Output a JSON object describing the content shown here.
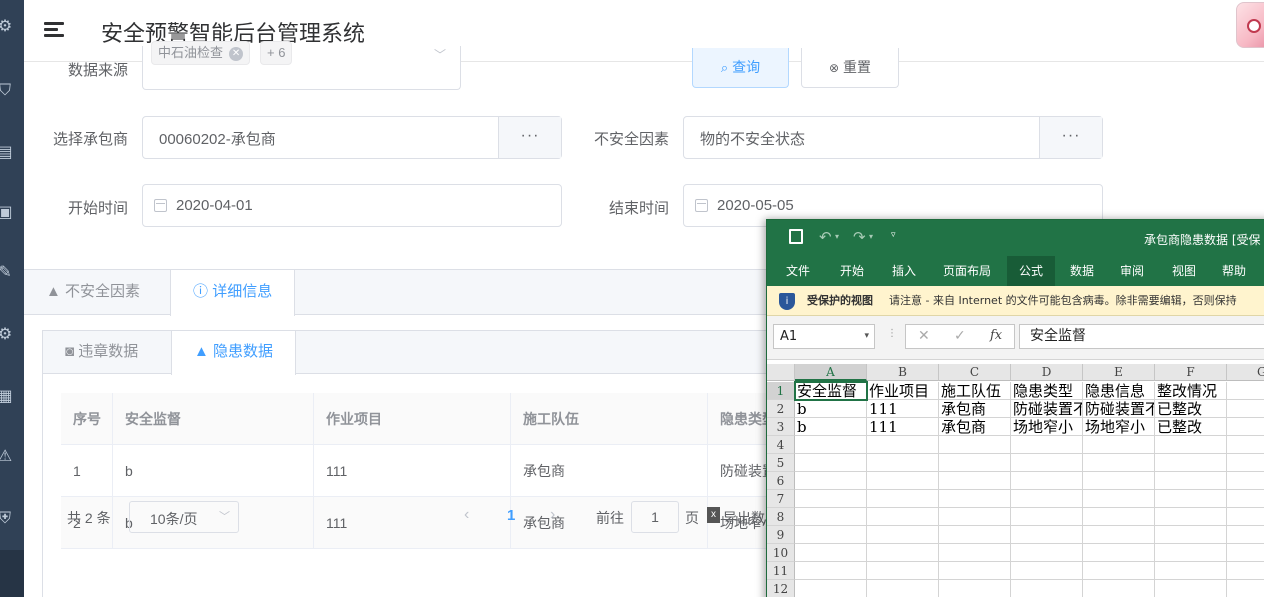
{
  "app": {
    "title": "安全预警智能后台管理系统"
  },
  "filters": {
    "data_source_label": "数据来源",
    "data_source_tag": "中石油检查",
    "data_source_more": "+ 6",
    "query_button": "查询",
    "reset_button": "重置",
    "contractor_label": "选择承包商",
    "contractor_value": "00060202-承包商",
    "unsafe_factor_label": "不安全因素",
    "unsafe_factor_value": "物的不安全状态",
    "start_label": "开始时间",
    "start_value": "2020-04-01",
    "end_label": "结束时间",
    "end_value": "2020-05-05",
    "more_button": "···"
  },
  "outer_tabs": [
    {
      "label": "不安全因素"
    },
    {
      "label": "详细信息"
    }
  ],
  "inner_tabs": [
    {
      "label": "违章数据"
    },
    {
      "label": "隐患数据"
    }
  ],
  "table": {
    "headers": [
      "序号",
      "安全监督",
      "作业项目",
      "施工队伍",
      "隐患类型"
    ],
    "rows": [
      [
        "1",
        "b",
        "111",
        "承包商",
        "防碰装置"
      ],
      [
        "2",
        "b",
        "111",
        "承包商",
        "场地窄小"
      ]
    ]
  },
  "pagination": {
    "total": "共 2 条",
    "page_size": "10条/页",
    "current_page": "1",
    "goto_label": "前往",
    "goto_value": "1",
    "page_suffix": "页",
    "export_label": "导出数"
  },
  "excel": {
    "title": "承包商隐患数据 [受保",
    "ribbon_tabs": [
      "文件",
      "开始",
      "插入",
      "页面布局",
      "公式",
      "数据",
      "审阅",
      "视图",
      "帮助"
    ],
    "warning_title": "受保护的视图",
    "warning_text": "请注意 - 来自 Internet 的文件可能包含病毒。除非需要编辑，否则保持",
    "name_box": "A1",
    "formula_value": "安全监督",
    "fx": "fx",
    "columns": [
      "A",
      "B",
      "C",
      "D",
      "E",
      "F",
      "G"
    ],
    "rows": [
      [
        "安全监督",
        "作业项目",
        "施工队伍",
        "隐患类型",
        "隐患信息",
        "整改情况"
      ],
      [
        "b",
        "111",
        "承包商",
        "防碰装置不",
        "防碰装置不",
        "已整改"
      ],
      [
        "b",
        "111",
        "承包商",
        "场地窄小",
        "场地窄小",
        "已整改"
      ]
    ],
    "row_numbers": [
      "1",
      "2",
      "3",
      "4",
      "5",
      "6",
      "7",
      "8",
      "9",
      "10",
      "11",
      "12"
    ]
  }
}
